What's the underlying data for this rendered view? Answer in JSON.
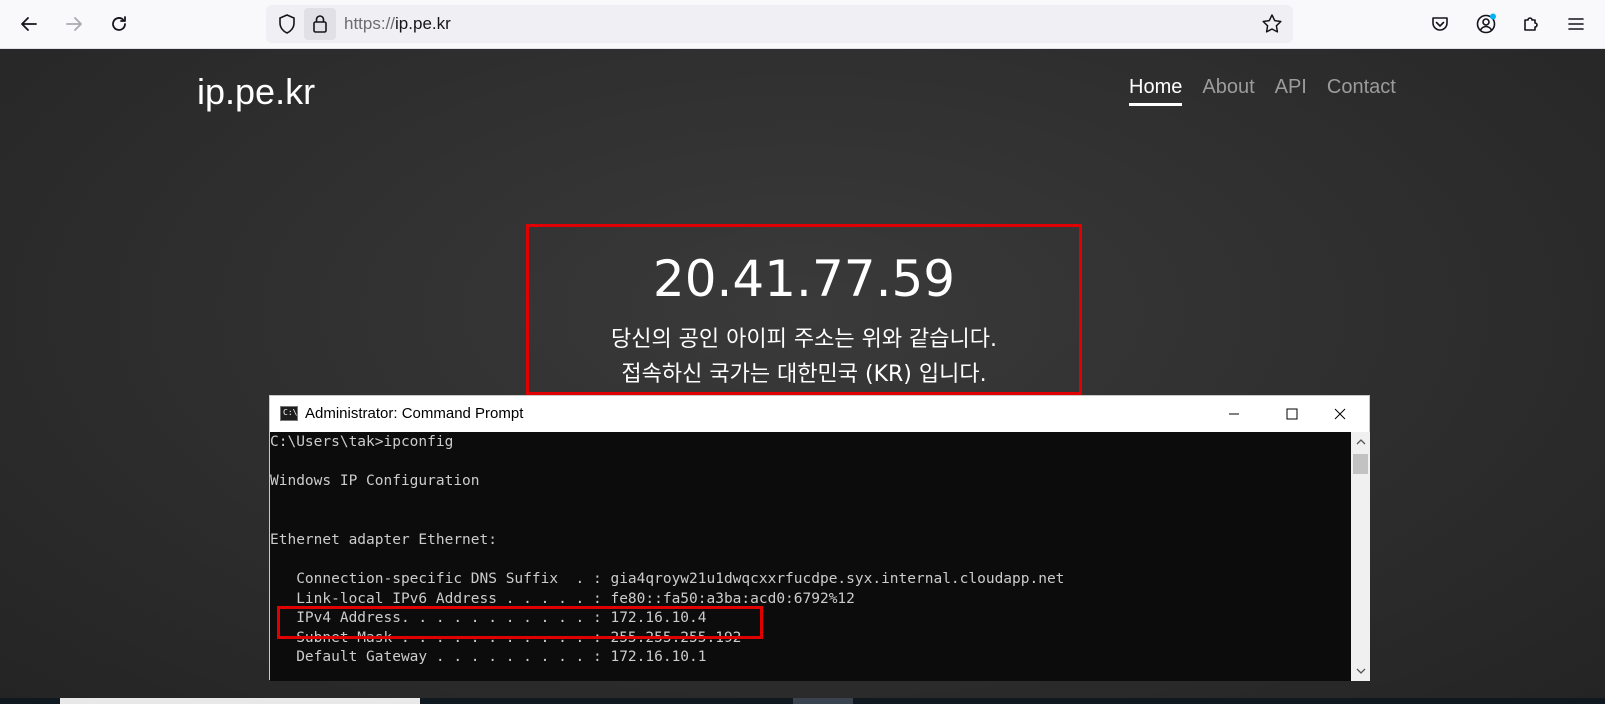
{
  "browser": {
    "url_scheme": "https://",
    "url_host": "ip.pe.kr"
  },
  "site": {
    "title": "ip.pe.kr",
    "nav": [
      {
        "label": "Home",
        "active": true
      },
      {
        "label": "About",
        "active": false
      },
      {
        "label": "API",
        "active": false
      },
      {
        "label": "Contact",
        "active": false
      }
    ],
    "ip_address": "20.41.77.59",
    "line1": "당신의 공인 아이피 주소는 위와 같습니다.",
    "line2": "접속하신 국가는 대한민국 (KR) 입니다.",
    "highlight_color": "#e00000"
  },
  "cmd": {
    "icon_text": "C:\\",
    "title": "Administrator: Command Prompt",
    "lines": [
      "C:\\Users\\tak>ipconfig",
      "Windows IP Configuration",
      "Ethernet adapter Ethernet:",
      "   Connection-specific DNS Suffix  . : gia4qroyw21u1dwqcxxrfucdpe.syx.internal.cloudapp.net",
      "   Link-local IPv6 Address . . . . . : fe80::fa50:a3ba:acd0:6792%12",
      "   IPv4 Address. . . . . . . . . . . : 172.16.10.4",
      "   Subnet Mask . . . . . . . . . . . : 255.255.255.192",
      "   Default Gateway . . . . . . . . . : 172.16.10.1"
    ]
  }
}
